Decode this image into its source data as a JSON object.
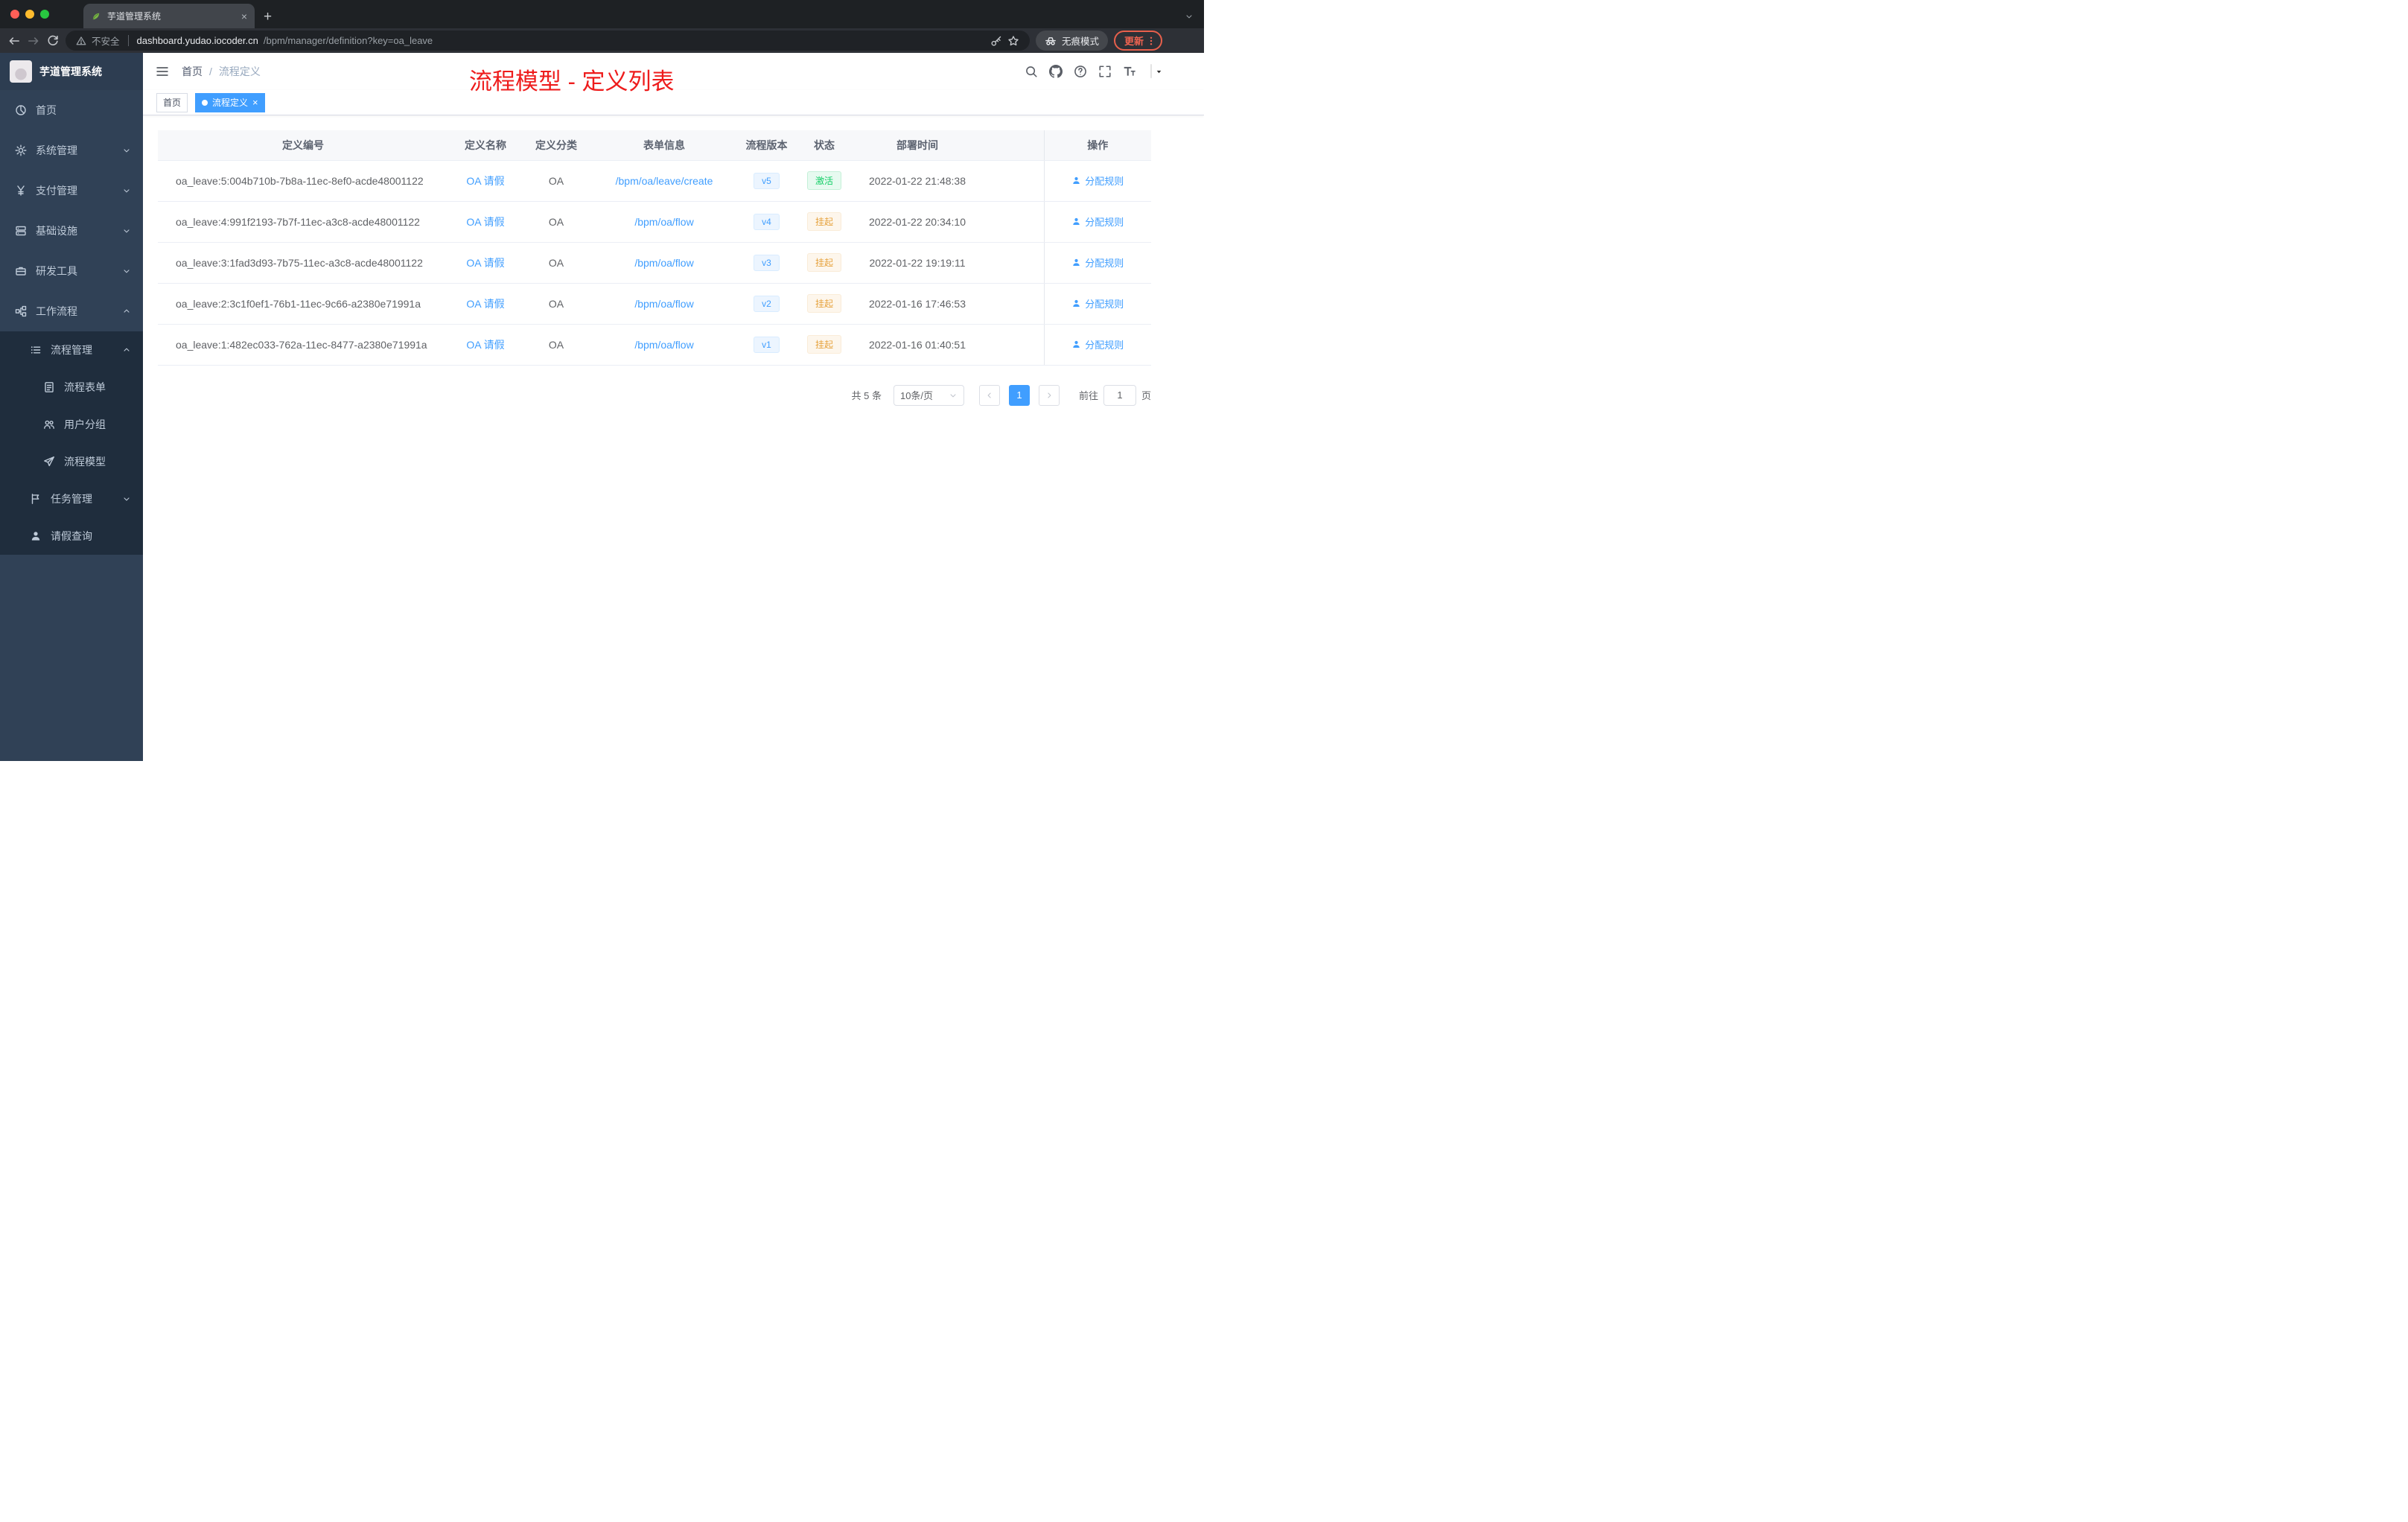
{
  "colors": {
    "accent_blue": "#409eff",
    "success_green": "#13ce66",
    "warning_orange": "#e6a23c",
    "annotation_red": "#ee1c1c",
    "sidebar_bg": "#304156",
    "submenu_bg": "#1f2d3d"
  },
  "browser": {
    "tab": {
      "title": "芋道管理系统"
    },
    "address": {
      "security_label": "不安全",
      "host": "dashboard.yudao.iocoder.cn",
      "path": "/bpm/manager/definition?key=oa_leave"
    },
    "incognito_label": "无痕模式",
    "update_label": "更新"
  },
  "sidebar": {
    "logo_title": "芋道管理系统",
    "items": [
      {
        "label": "首页",
        "icon": "dashboard-icon",
        "level": 0,
        "chevron": "none"
      },
      {
        "label": "系统管理",
        "icon": "gear-icon",
        "level": 0,
        "chevron": "down"
      },
      {
        "label": "支付管理",
        "icon": "yen-icon",
        "level": 0,
        "chevron": "down"
      },
      {
        "label": "基础设施",
        "icon": "server-icon",
        "level": 0,
        "chevron": "down"
      },
      {
        "label": "研发工具",
        "icon": "tool-icon",
        "level": 0,
        "chevron": "down"
      },
      {
        "label": "工作流程",
        "icon": "workflow-icon",
        "level": 0,
        "chevron": "up"
      },
      {
        "label": "流程管理",
        "icon": "list-icon",
        "level": 1,
        "chevron": "up"
      },
      {
        "label": "流程表单",
        "icon": "form-icon",
        "level": 2,
        "chevron": "none"
      },
      {
        "label": "用户分组",
        "icon": "users-icon",
        "level": 2,
        "chevron": "none"
      },
      {
        "label": "流程模型",
        "icon": "send-icon",
        "level": 2,
        "chevron": "none"
      },
      {
        "label": "任务管理",
        "icon": "task-icon",
        "level": 1,
        "chevron": "down"
      },
      {
        "label": "请假查询",
        "icon": "user-icon",
        "level": 1,
        "chevron": "none"
      }
    ]
  },
  "header": {
    "breadcrumb": {
      "home": "首页",
      "separator": "/",
      "current": "流程定义"
    },
    "annotation": "流程模型 - 定义列表"
  },
  "tags": {
    "items": [
      {
        "label": "首页",
        "active": false
      },
      {
        "label": "流程定义",
        "active": true
      }
    ]
  },
  "table": {
    "headers": [
      "定义编号",
      "定义名称",
      "定义分类",
      "表单信息",
      "流程版本",
      "状态",
      "部署时间",
      "操作"
    ],
    "rows": [
      {
        "id": "oa_leave:5:004b710b-7b8a-11ec-8ef0-acde48001122",
        "name": "OA 请假",
        "category": "OA",
        "form": "/bpm/oa/leave/create",
        "version": "v5",
        "status": "激活",
        "status_type": "success",
        "deploy_time": "2022-01-22 21:48:38",
        "action": "分配规则"
      },
      {
        "id": "oa_leave:4:991f2193-7b7f-11ec-a3c8-acde48001122",
        "name": "OA 请假",
        "category": "OA",
        "form": "/bpm/oa/flow",
        "version": "v4",
        "status": "挂起",
        "status_type": "warning",
        "deploy_time": "2022-01-22 20:34:10",
        "action": "分配规则"
      },
      {
        "id": "oa_leave:3:1fad3d93-7b75-11ec-a3c8-acde48001122",
        "name": "OA 请假",
        "category": "OA",
        "form": "/bpm/oa/flow",
        "version": "v3",
        "status": "挂起",
        "status_type": "warning",
        "deploy_time": "2022-01-22 19:19:11",
        "action": "分配规则"
      },
      {
        "id": "oa_leave:2:3c1f0ef1-76b1-11ec-9c66-a2380e71991a",
        "name": "OA 请假",
        "category": "OA",
        "form": "/bpm/oa/flow",
        "version": "v2",
        "status": "挂起",
        "status_type": "warning",
        "deploy_time": "2022-01-16 17:46:53",
        "action": "分配规则"
      },
      {
        "id": "oa_leave:1:482ec033-762a-11ec-8477-a2380e71991a",
        "name": "OA 请假",
        "category": "OA",
        "form": "/bpm/oa/flow",
        "version": "v1",
        "status": "挂起",
        "status_type": "warning",
        "deploy_time": "2022-01-16 01:40:51",
        "action": "分配规则"
      }
    ]
  },
  "pagination": {
    "total": "共 5 条",
    "page_size": "10条/页",
    "current_page": "1",
    "goto_prefix": "前往",
    "goto_value": "1",
    "goto_suffix": "页"
  }
}
